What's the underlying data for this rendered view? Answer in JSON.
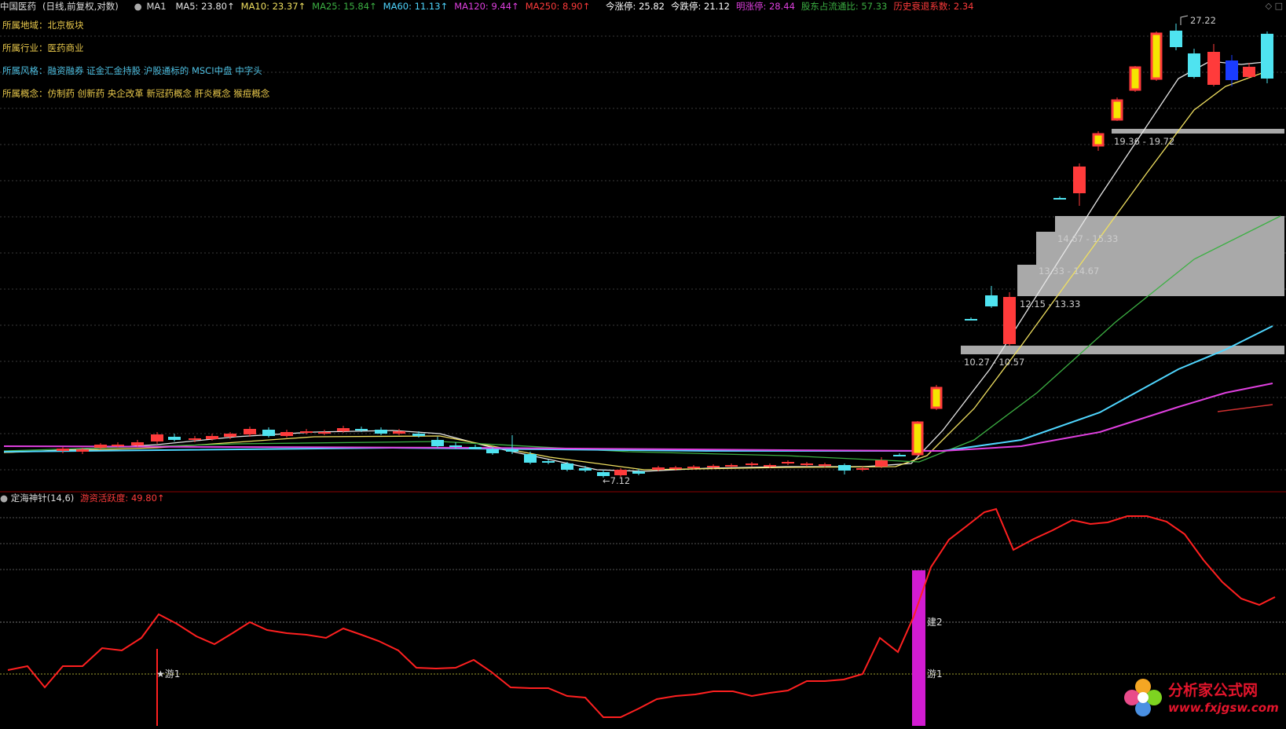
{
  "header": {
    "stock_name": "中国医药",
    "mode": "(日线,前复权,对数)",
    "ma_label": "MA1",
    "ma": [
      {
        "text": "MA5: 23.80↑",
        "color": "#e6e6e6"
      },
      {
        "text": "MA10: 23.37↑",
        "color": "#f0e060"
      },
      {
        "text": "MA25: 15.84↑",
        "color": "#3cb043"
      },
      {
        "text": "MA60: 11.13↑",
        "color": "#4fd6ff"
      },
      {
        "text": "MA120: 9.44↑",
        "color": "#e040e0"
      },
      {
        "text": "MA250: 8.90↑",
        "color": "#ff3b3b"
      }
    ],
    "extras": [
      {
        "text": "今涨停: 25.82",
        "color": "#ffffff"
      },
      {
        "text": "今跌停: 21.12",
        "color": "#ffffff"
      },
      {
        "text": "明涨停: 28.44",
        "color": "#e040e0"
      },
      {
        "text": "股东占流通比: 57.33",
        "color": "#3cb043"
      },
      {
        "text": "历史衰退系数: 2.34",
        "color": "#ff3b3b"
      }
    ],
    "icons": [
      "diamond-icon",
      "window-icon"
    ]
  },
  "info": {
    "region_label": "所属地域：",
    "region_value": "北京板块",
    "industry_label": "所属行业：",
    "industry_value": "医药商业",
    "style_label": "所属风格：",
    "style_value": "融资融券 证金汇金持股 沪股通标的 MSCI中盘 中字头",
    "concept_label": "所属概念：",
    "concept_value": "仿制药 创新药 央企改革 新冠药概念 肝炎概念 猴痘概念"
  },
  "chart_labels": {
    "high": "27.22",
    "low": "←7.12",
    "zone1": "10.27 - 10.57",
    "zone2": "12.15 - 13.33",
    "zone3": "13.33 - 14.67",
    "zone4": "14.67 - 15.33",
    "zone5": "19.36 - 19.72"
  },
  "indicator": {
    "name": "定海神针(14,6)",
    "value_text": "游资活跃度: 49.80↑",
    "marker_star": "★游1",
    "marker_jian": "建2",
    "marker_you": "游1"
  },
  "colors": {
    "up": "#ff3b3b",
    "down": "#4fe3f0",
    "line": "#ff2020",
    "volume_bar": "#d21cd2"
  },
  "logo": {
    "name": "分析家公式网",
    "url": "www.fxjgsw.com"
  }
}
